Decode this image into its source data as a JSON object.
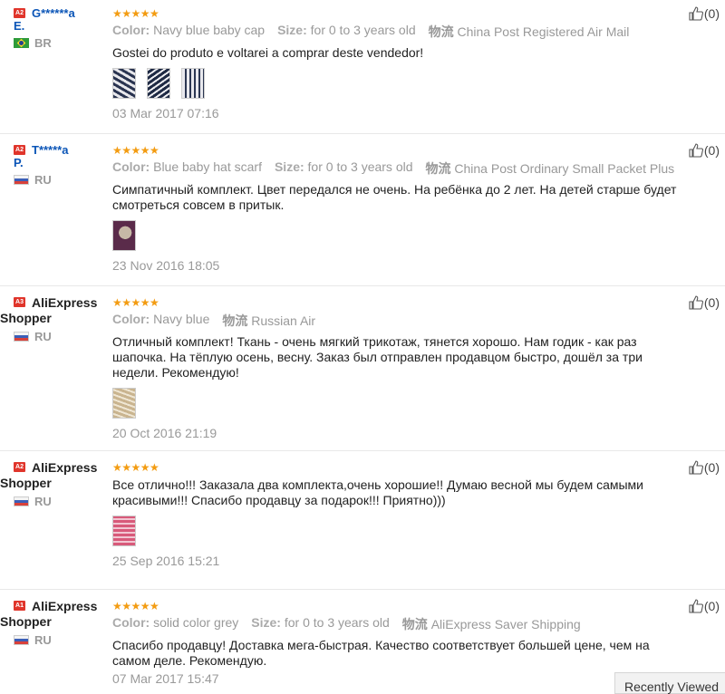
{
  "reviews": [
    {
      "level": "A2",
      "name": "G******a",
      "name_rest": "E.",
      "country_code": "BR",
      "stars": "★★★★★",
      "attrs": [
        {
          "label": "Color:",
          "value": "Navy blue baby cap"
        },
        {
          "label": "Size:",
          "value": "for 0 to 3 years old"
        },
        {
          "label": "物流",
          "value": "China Post Registered Air Mail"
        }
      ],
      "text": "Gostei do produto e voltarei a comprar deste vendedor!",
      "date": "03 Mar 2017 07:16",
      "useful": "(0)"
    },
    {
      "level": "A2",
      "name": "T*****a",
      "name_rest": "P.",
      "country_code": "RU",
      "stars": "★★★★★",
      "attrs": [
        {
          "label": "Color:",
          "value": "Blue baby hat scarf"
        },
        {
          "label": "Size:",
          "value": "for 0 to 3 years old"
        },
        {
          "label": "物流",
          "value": "China Post Ordinary Small Packet Plus"
        }
      ],
      "text": "Симпатичный комплект. Цвет передался не очень. На ребёнка до 2 лет. На детей старше будет смотреться совсем в притык.",
      "date": "23 Nov 2016 18:05",
      "useful": "(0)"
    },
    {
      "level": "A3",
      "name": "AliExpress",
      "name_rest": "Shopper",
      "country_code": "RU",
      "stars": "★★★★★",
      "attrs": [
        {
          "label": "Color:",
          "value": "Navy blue"
        },
        {
          "label": "物流",
          "value": "Russian Air"
        }
      ],
      "text": "Отличный комплект! Ткань - очень мягкий трикотаж, тянется хорошо. Нам годик - как раз шапочка. На тёплую осень, весну. Заказ был отправлен продавцом быстро, дошёл за три недели. Рекомендую!",
      "date": "20 Oct 2016 21:19",
      "useful": "(0)"
    },
    {
      "level": "A2",
      "name": "AliExpress",
      "name_rest": "Shopper",
      "country_code": "RU",
      "stars": "★★★★★",
      "attrs": [],
      "text": "Все отлично!!! Заказала два комплекта,очень хорошие!! Думаю весной мы будем самыми красивыми!!! Спасибо продавцу за подарок!!! Приятно)))",
      "date": "25 Sep 2016 15:21",
      "useful": "(0)"
    },
    {
      "level": "A1",
      "name": "AliExpress",
      "name_rest": "Shopper",
      "country_code": "RU",
      "stars": "★★★★★",
      "attrs": [
        {
          "label": "Color:",
          "value": "solid color grey"
        },
        {
          "label": "Size:",
          "value": "for 0 to 3 years old"
        },
        {
          "label": "物流",
          "value": "AliExpress Saver Shipping"
        }
      ],
      "text": "Спасибо продавцу! Доставка мега-быстрая. Качество соответствует большей цене, чем на самом деле. Рекомендую.",
      "date": "07 Mar 2017 15:47",
      "useful": "(0)"
    }
  ],
  "recently_viewed": "Recently Viewed"
}
